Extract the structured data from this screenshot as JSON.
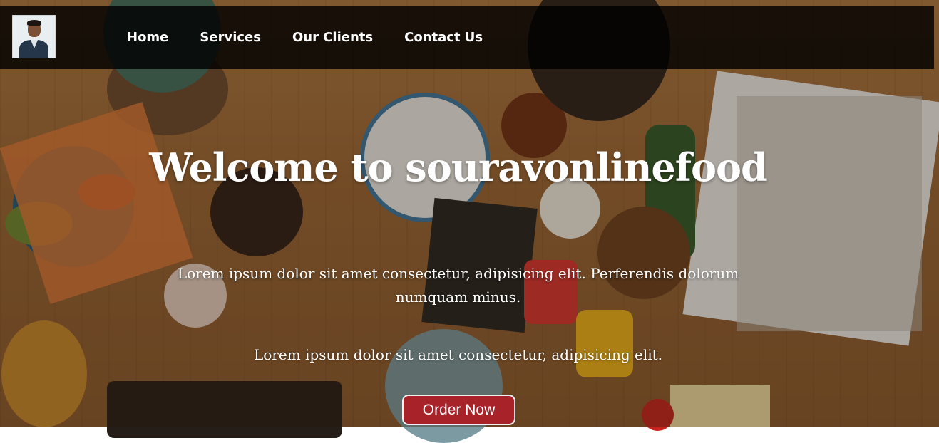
{
  "colors": {
    "navbar_bg": "#000000",
    "button_bg": "#a8222a",
    "text": "#ffffff"
  },
  "logo": {
    "alt": "profile-avatar"
  },
  "nav": {
    "items": [
      {
        "label": "Home"
      },
      {
        "label": "Services"
      },
      {
        "label": "Our Clients"
      },
      {
        "label": "Contact Us"
      }
    ]
  },
  "hero": {
    "title": "Welcome to souravonlinefood",
    "paragraph1": "Lorem ipsum dolor sit amet consectetur, adipisicing elit. Perferendis dolorum numquam minus.",
    "paragraph2": "Lorem ipsum dolor sit amet consectetur, adipisicing elit.",
    "cta_label": "Order Now"
  }
}
